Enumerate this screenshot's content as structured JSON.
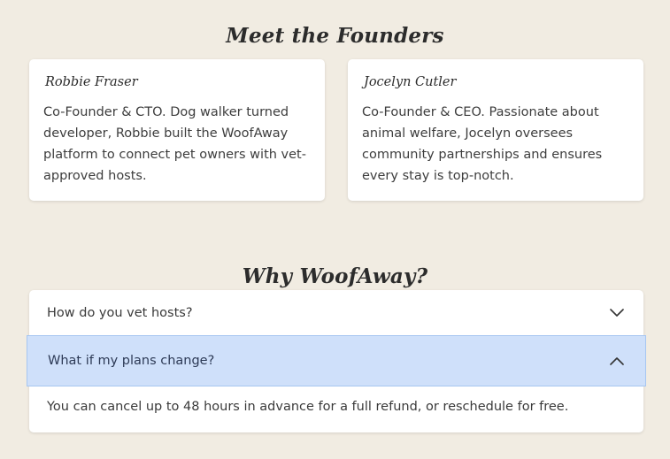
{
  "founders": {
    "title": "Meet the Founders",
    "people": [
      {
        "name": "Robbie Fraser",
        "bio": "Co-Founder & CTO. Dog walker turned developer, Robbie built the WoofAway platform to connect pet owners with vet-approved hosts."
      },
      {
        "name": "Jocelyn Cutler",
        "bio": "Co-Founder & CEO. Passionate about animal welfare, Jocelyn oversees community partnerships and ensures every stay is top-notch."
      }
    ]
  },
  "why": {
    "title": "Why WoofAway?",
    "faq": [
      {
        "question": "How do you vet hosts?",
        "expanded": false,
        "icon": "chevron-down-icon"
      },
      {
        "question": "What if my plans change?",
        "expanded": true,
        "icon": "chevron-up-icon",
        "answer": "You can cancel up to 48 hours in advance for a full refund, or reschedule for free."
      }
    ]
  },
  "colors": {
    "background": "#f1ece2",
    "card": "#ffffff",
    "highlight": "#cfe0fa",
    "highlight_border": "#a7c6f1"
  }
}
